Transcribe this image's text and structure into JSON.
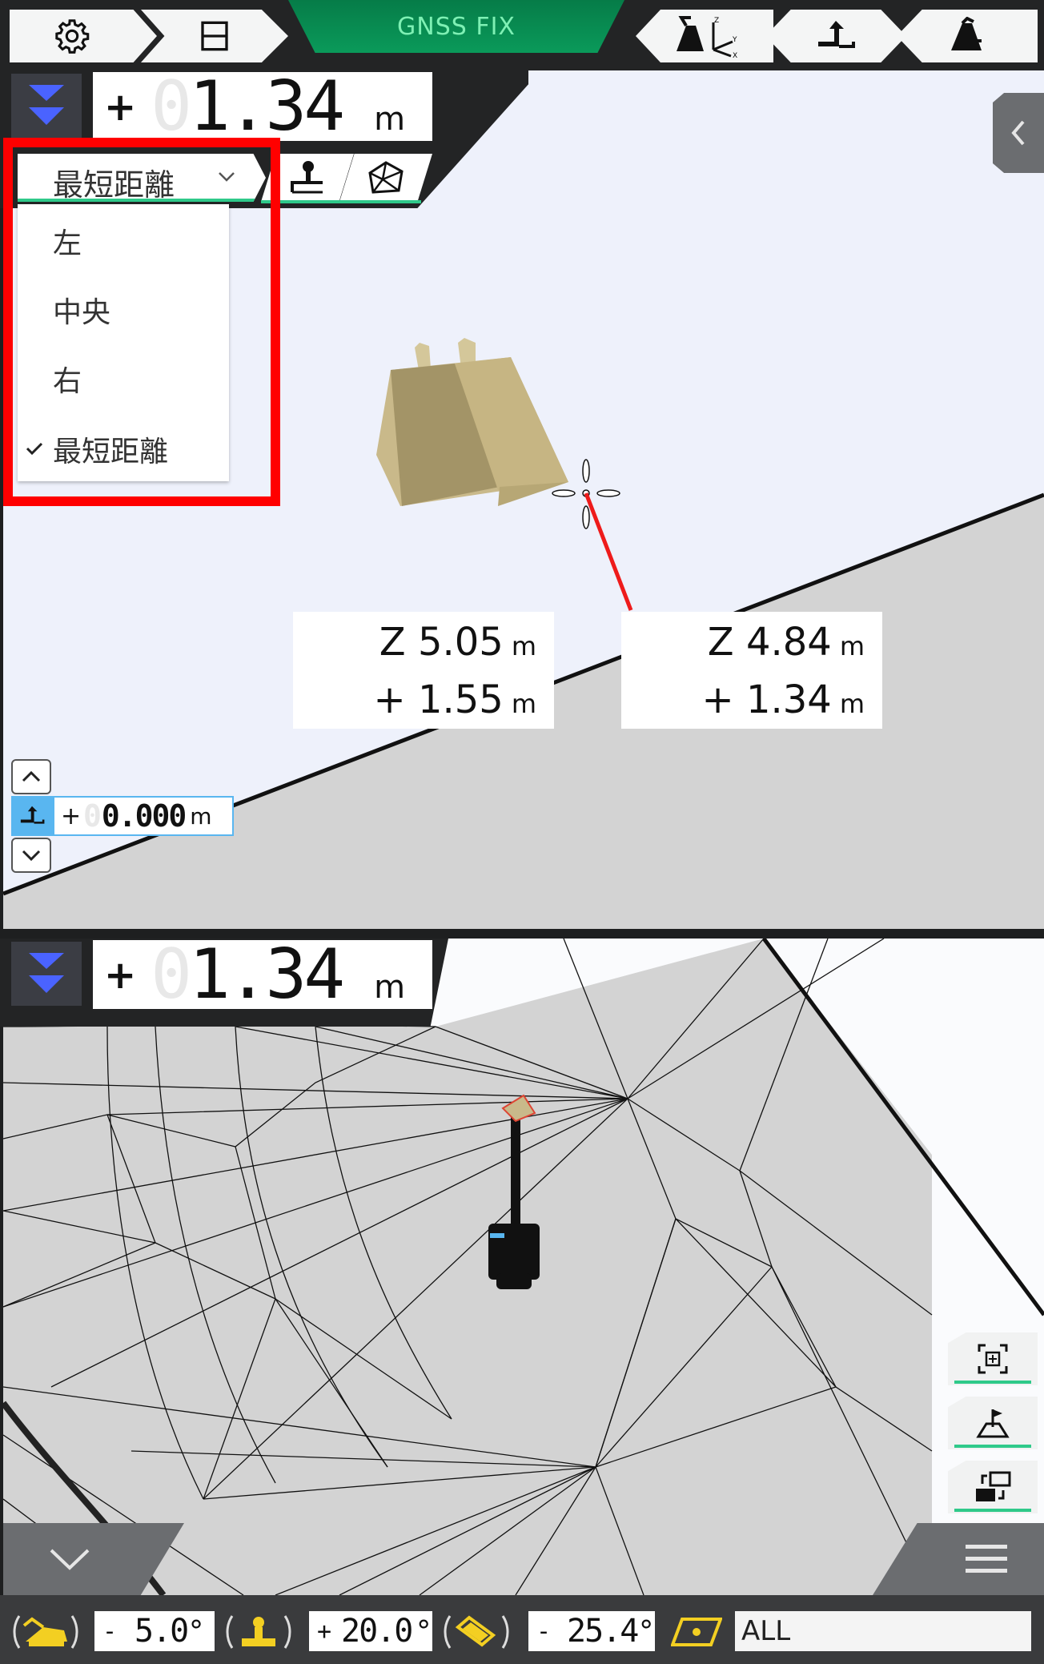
{
  "header": {
    "gnss_status": "GNSS FIX"
  },
  "upper_panel": {
    "readout": {
      "sign": "+",
      "ghost_digit": "0",
      "value": "1.34",
      "unit": "m"
    },
    "dropdown": {
      "selected": "最短距離",
      "options": [
        {
          "label": "左",
          "checked": false
        },
        {
          "label": "中央",
          "checked": false
        },
        {
          "label": "右",
          "checked": false
        },
        {
          "label": "最短距離",
          "checked": true
        }
      ]
    },
    "label_left": {
      "z_prefix": "Z",
      "z_value": "5.05",
      "z_unit": "m",
      "d_prefix": "+",
      "d_value": "1.55",
      "d_unit": "m"
    },
    "label_right": {
      "z_prefix": "Z",
      "z_value": "4.84",
      "z_unit": "m",
      "d_prefix": "+",
      "d_value": "1.34",
      "d_unit": "m"
    },
    "offset": {
      "sign": "+",
      "ghost_digit": "0",
      "value": "0.000",
      "unit": "m"
    }
  },
  "lower_panel": {
    "readout": {
      "sign": "+",
      "ghost_digit": "0",
      "value": "1.34",
      "unit": "m"
    }
  },
  "bottom_bar": {
    "pitch": {
      "sign": "-",
      "value": "5.0",
      "unit": "°"
    },
    "roll": {
      "sign": "+",
      "value": "20.0",
      "unit": "°"
    },
    "bucket": {
      "sign": "-",
      "value": "25.4",
      "unit": "°"
    },
    "surface_filter": "ALL"
  },
  "colors": {
    "accent_green": "#0a9a5a",
    "gnss_text": "#7ef0b4",
    "chevron_blue": "#4a63ff",
    "highlight_red": "#ff0000",
    "bucket_tan": "#c9b98a",
    "ground_gray": "#d3d3d3",
    "offset_blue": "#59b6f0",
    "icon_yellow": "#f3cf22"
  },
  "icons": {
    "settings": "gear-icon",
    "layout": "split-view-icon",
    "coordinate": "excavator-axes-icon",
    "reference": "reference-line-icon",
    "bucket": "bucket-icon",
    "collapse": "chevron-left-icon",
    "menu": "hamburger-icon"
  }
}
